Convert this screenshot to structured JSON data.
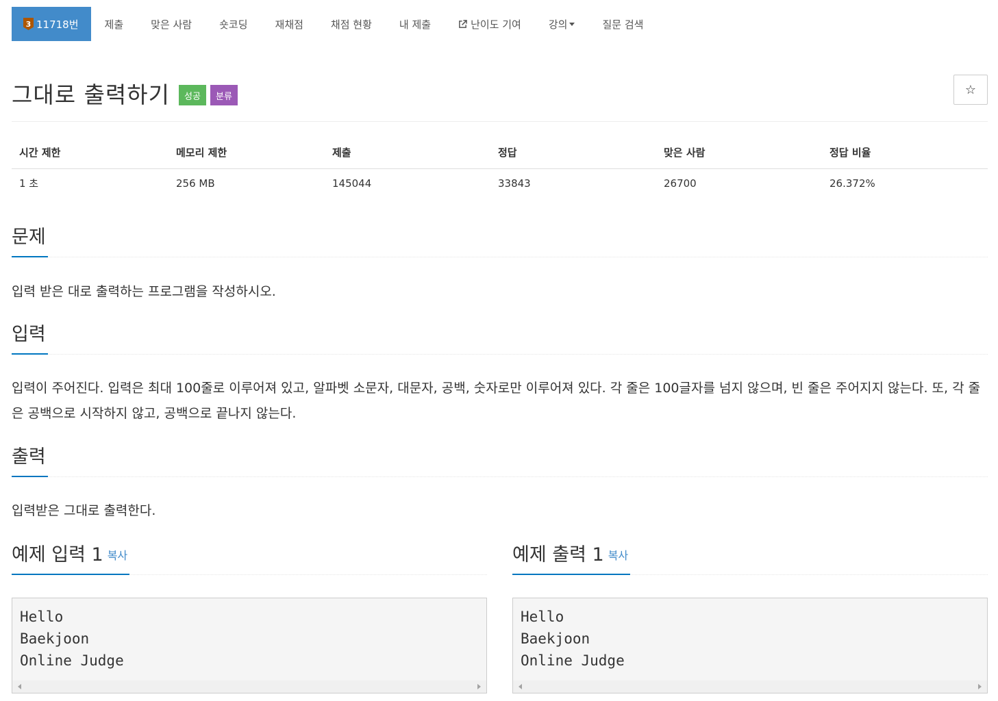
{
  "nav": {
    "active": {
      "tier": "3",
      "label": "11718번"
    },
    "items": [
      "제출",
      "맞은 사람",
      "숏코딩",
      "재채점",
      "채점 현황",
      "내 제출",
      "난이도 기여",
      "강의",
      "질문 검색"
    ]
  },
  "problem": {
    "title": "그대로 출력하기",
    "badge_success": "성공",
    "badge_category": "분류",
    "star": "☆"
  },
  "stats": {
    "headers": [
      "시간 제한",
      "메모리 제한",
      "제출",
      "정답",
      "맞은 사람",
      "정답 비율"
    ],
    "values": [
      "1 초",
      "256 MB",
      "145044",
      "33843",
      "26700",
      "26.372%"
    ]
  },
  "sections": {
    "problem": {
      "heading": "문제",
      "text": "입력 받은 대로 출력하는 프로그램을 작성하시오."
    },
    "input": {
      "heading": "입력",
      "text": "입력이 주어진다. 입력은 최대 100줄로 이루어져 있고, 알파벳 소문자, 대문자, 공백, 숫자로만 이루어져 있다. 각 줄은 100글자를 넘지 않으며, 빈 줄은 주어지지 않는다. 또, 각 줄은 공백으로 시작하지 않고, 공백으로 끝나지 않는다."
    },
    "output": {
      "heading": "출력",
      "text": "입력받은 그대로 출력한다."
    }
  },
  "samples": {
    "input": {
      "heading": "예제 입력 1",
      "copy": "복사",
      "content": "Hello\nBaekjoon\nOnline Judge"
    },
    "output": {
      "heading": "예제 출력 1",
      "copy": "복사",
      "content": "Hello\nBaekjoon\nOnline Judge"
    }
  }
}
